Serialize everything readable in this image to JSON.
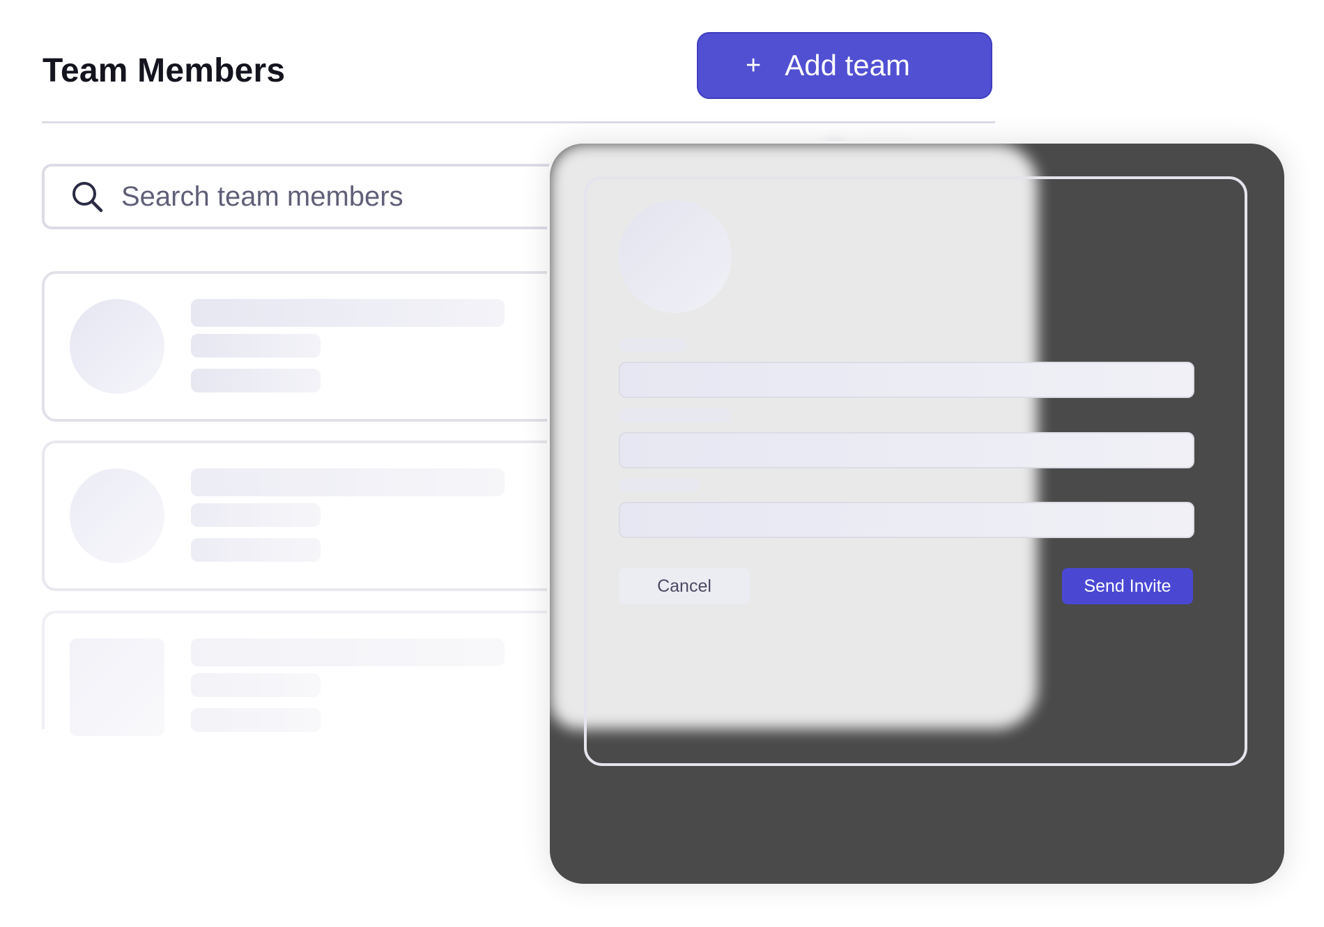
{
  "header": {
    "title": "Team Members",
    "add_team_icon": "+",
    "add_team_label": "Add team"
  },
  "search": {
    "icon": "search-icon",
    "placeholder": "Search team members"
  },
  "invite_modal": {
    "cancel_label": "Cancel",
    "send_label": "Send Invite"
  },
  "colors": {
    "accent": "#5150d2",
    "modal_backdrop": "#4a4a4a"
  }
}
